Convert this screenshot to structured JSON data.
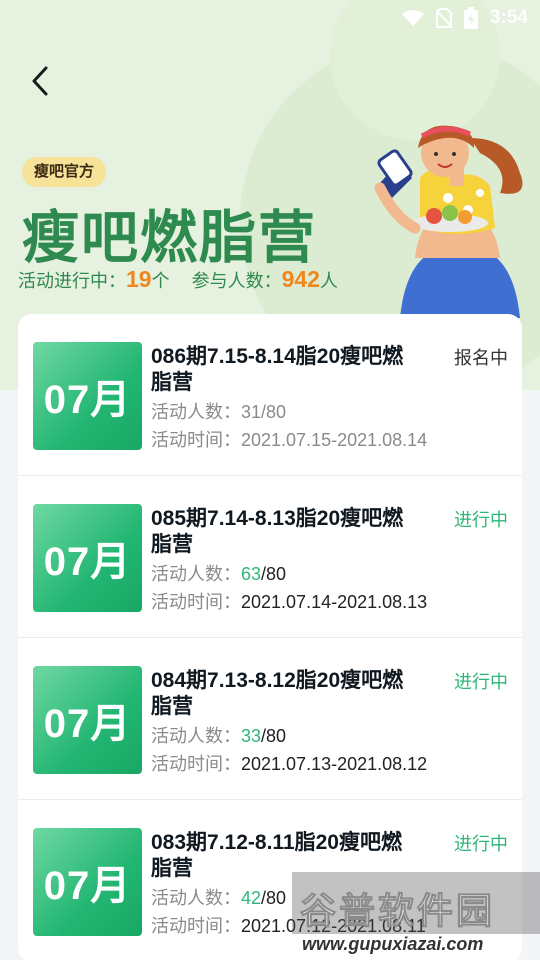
{
  "status_bar": {
    "time": "3:54"
  },
  "header": {
    "badge": "瘦吧官方",
    "title": "瘦吧燃脂营",
    "stats": {
      "active_label": "活动进行中：",
      "active_count": "19",
      "active_unit": "个",
      "participants_label": "参与人数：",
      "participants_count": "942",
      "participants_unit": "人"
    }
  },
  "camps": [
    {
      "cover": "07月",
      "name": "086期7.15-8.14脂20瘦吧燃脂营",
      "status": "报名中",
      "count_label": "活动人数：",
      "count_now": "31",
      "count_max": "/80",
      "time_label": "活动时间：",
      "time": "2021.07.15-2021.08.14"
    },
    {
      "cover": "07月",
      "name": "085期7.14-8.13脂20瘦吧燃脂营",
      "status": "进行中",
      "count_label": "活动人数：",
      "count_now": "63",
      "count_max": "/80",
      "time_label": "活动时间：",
      "time": "2021.07.14-2021.08.13"
    },
    {
      "cover": "07月",
      "name": "084期7.13-8.12脂20瘦吧燃脂营",
      "status": "进行中",
      "count_label": "活动人数：",
      "count_now": "33",
      "count_max": "/80",
      "time_label": "活动时间：",
      "time": "2021.07.13-2021.08.12"
    },
    {
      "cover": "07月",
      "name": "083期7.12-8.11脂20瘦吧燃脂营",
      "status": "进行中",
      "count_label": "活动人数：",
      "count_now": "42",
      "count_max": "/80",
      "time_label": "活动时间：",
      "time": "2021.07.12-2021.08.11"
    }
  ],
  "watermark": {
    "text": "谷普软件园",
    "url": "www.gupuxiazai.com"
  },
  "colors": {
    "accent": "#2db77a",
    "title": "#2e8a4e",
    "highlight": "#f0871e",
    "badge": "#f7e29a"
  }
}
